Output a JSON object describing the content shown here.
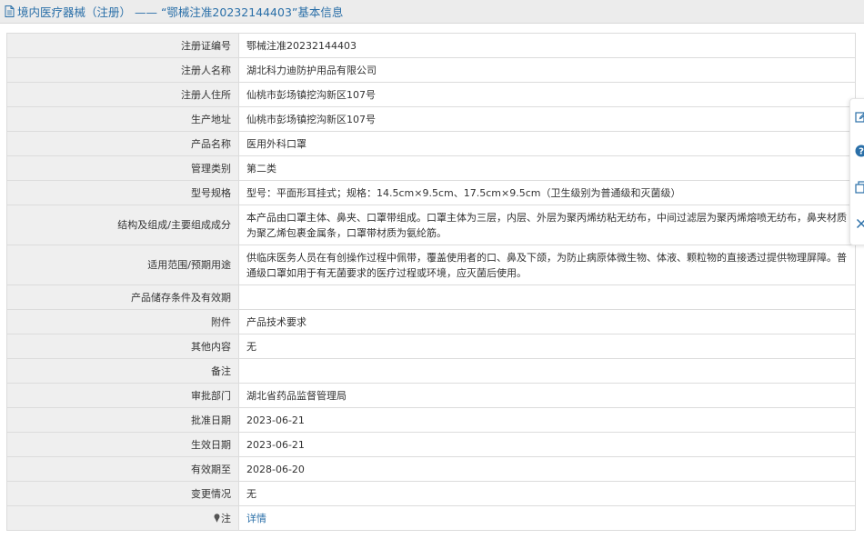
{
  "header": {
    "title": "境内医疗器械（注册） —— “鄂械注准20232144403”基本信息",
    "icon": "document-icon"
  },
  "rows": [
    {
      "label": "注册证编号",
      "value": "鄂械注准20232144403"
    },
    {
      "label": "注册人名称",
      "value": "湖北科力迪防护用品有限公司"
    },
    {
      "label": "注册人住所",
      "value": "仙桃市彭场镇挖沟新区107号"
    },
    {
      "label": "生产地址",
      "value": "仙桃市彭场镇挖沟新区107号"
    },
    {
      "label": "产品名称",
      "value": "医用外科口罩"
    },
    {
      "label": "管理类别",
      "value": "第二类"
    },
    {
      "label": "型号规格",
      "value": "型号：平面形耳挂式；规格：14.5cm×9.5cm、17.5cm×9.5cm（卫生级别为普通级和灭菌级）"
    },
    {
      "label": "结构及组成/主要组成成分",
      "value": "本产品由口罩主体、鼻夹、口罩带组成。口罩主体为三层，内层、外层为聚丙烯纺粘无纺布，中间过滤层为聚丙烯熔喷无纺布，鼻夹材质为聚乙烯包裹金属条，口罩带材质为氨纶筋。"
    },
    {
      "label": "适用范围/预期用途",
      "value": "供临床医务人员在有创操作过程中佩带，覆盖使用者的口、鼻及下颌，为防止病原体微生物、体液、颗粒物的直接透过提供物理屏障。普通级口罩如用于有无菌要求的医疗过程或环境，应灭菌后使用。"
    },
    {
      "label": "产品储存条件及有效期",
      "value": ""
    },
    {
      "label": "附件",
      "value": "产品技术要求"
    },
    {
      "label": "其他内容",
      "value": "无"
    },
    {
      "label": "备注",
      "value": ""
    },
    {
      "label": "审批部门",
      "value": "湖北省药品监督管理局"
    },
    {
      "label": "批准日期",
      "value": "2023-06-21"
    },
    {
      "label": "生效日期",
      "value": "2023-06-21"
    },
    {
      "label": "有效期至",
      "value": "2028-06-20"
    },
    {
      "label": "变更情况",
      "value": "无"
    }
  ],
  "note_row": {
    "label": "注",
    "link": "详情",
    "icon": "pin-icon"
  },
  "sidebar": {
    "icons": [
      "edit-icon",
      "help-icon",
      "copy-icon",
      "close-icon"
    ],
    "help_glyph": "?"
  },
  "colors": {
    "header_text": "#2a6fa8",
    "label_bg": "#efefef",
    "border": "#dcdcdc",
    "link": "#2a6fa8",
    "help_circle": "#2a6fa8"
  }
}
